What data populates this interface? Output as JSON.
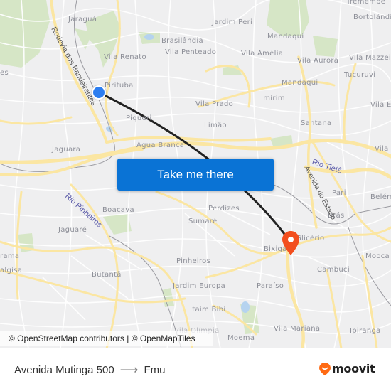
{
  "map": {
    "places": [
      {
        "name": "Jaraguá"
      },
      {
        "name": "Brasilândia"
      },
      {
        "name": "Jardim Peri"
      },
      {
        "name": "Mandaqui"
      },
      {
        "name": "Tremembé"
      },
      {
        "name": "Bortolândia"
      },
      {
        "name": "Vila Renato"
      },
      {
        "name": "Vila Penteado"
      },
      {
        "name": "Vila Amélia"
      },
      {
        "name": "Vila Aurora"
      },
      {
        "name": "Vila Mazzei"
      },
      {
        "name": "Tucuruvi"
      },
      {
        "name": "Pirituba"
      },
      {
        "name": "Mandaqui"
      },
      {
        "name": "Vila Prado"
      },
      {
        "name": "Imirim"
      },
      {
        "name": "Vila E"
      },
      {
        "name": "Piqueri"
      },
      {
        "name": "Limão"
      },
      {
        "name": "Santana"
      },
      {
        "name": "Jaguara"
      },
      {
        "name": "Água Branca"
      },
      {
        "name": "Vila"
      },
      {
        "name": "Pari"
      },
      {
        "name": "Belém"
      },
      {
        "name": "Boaçava"
      },
      {
        "name": "Perdizes"
      },
      {
        "name": "Brás"
      },
      {
        "name": "Jaguaré"
      },
      {
        "name": "Sumaré"
      },
      {
        "name": "Glicério"
      },
      {
        "name": "Bixiga"
      },
      {
        "name": "Mooca"
      },
      {
        "name": "rama"
      },
      {
        "name": "Pinheiros"
      },
      {
        "name": "algisa"
      },
      {
        "name": "Cambuci"
      },
      {
        "name": "Butantã"
      },
      {
        "name": "Jardim Europa"
      },
      {
        "name": "Paraíso"
      },
      {
        "name": "Itaim Bibi"
      },
      {
        "name": "Vila Mariana"
      },
      {
        "name": "Ipiranga"
      },
      {
        "name": "Moema"
      },
      {
        "name": "Vila Olímpia"
      },
      {
        "name": "es"
      }
    ],
    "roads": {
      "bandeirantes": "Rodovia dos Bandeirantes",
      "avenida_estado": "Avenida do Estado"
    },
    "rivers": {
      "tiete": "Rio Tietê",
      "pinheiros": "Rio Pinheiros"
    },
    "origin_marker": "origin",
    "destination_marker": "destination",
    "colors": {
      "route_line": "#222222",
      "origin": "#2d7ef0",
      "destination": "#f24e1e",
      "major_road": "#fbe6a2",
      "park": "#cfe3bd",
      "water": "#a9cdee"
    }
  },
  "cta": {
    "label": "Take me there",
    "color": "#0a73d5"
  },
  "attribution": {
    "text": "© OpenStreetMap contributors | © OpenMapTiles"
  },
  "footer": {
    "origin": "Avenida Mutinga 500",
    "arrow": "⟶",
    "destination": "Fmu",
    "brand": "moovit",
    "brand_color": "#ff6a13"
  }
}
